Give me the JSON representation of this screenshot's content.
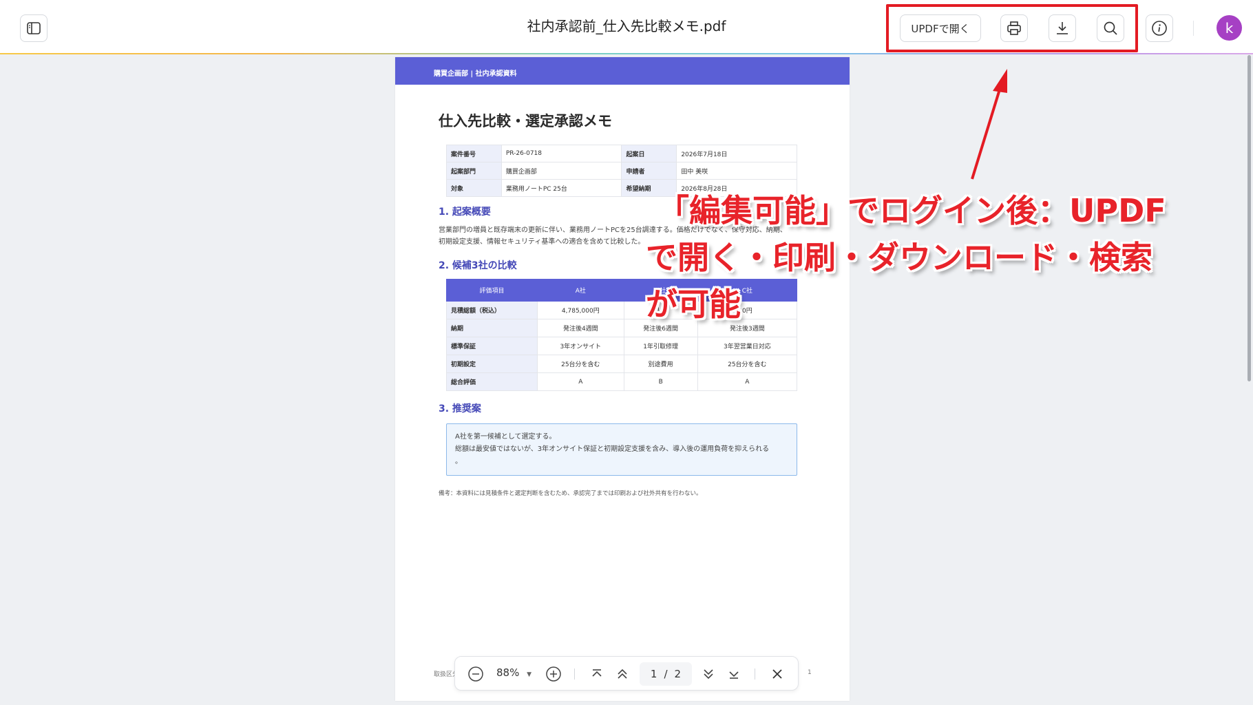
{
  "header": {
    "title": "社内承認前_仕入先比較メモ.pdf",
    "open_in_updf_label": "UPDFで開く",
    "avatar_initial": "k"
  },
  "document": {
    "header_band": "購買企画部 | 社内承認資料",
    "title": "仕入先比較・選定承認メモ",
    "meta": [
      {
        "k1": "案件番号",
        "v1": "PR-26-0718",
        "k2": "起案日",
        "v2": "2026年7月18日"
      },
      {
        "k1": "起案部門",
        "v1": "購買企画部",
        "k2": "申請者",
        "v2": "田中 美咲"
      },
      {
        "k1": "対象",
        "v1": "業務用ノートPC 25台",
        "k2": "希望納期",
        "v2": "2026年8月28日"
      }
    ],
    "sections": {
      "s1": "1. 起案概要",
      "s2": "2. 候補3社の比較",
      "s3": "3. 推奨案"
    },
    "summary_lines": [
      "営業部門の増員と既存端末の更新に伴い、業務用ノートPCを25台調達する。価格だけでなく、保守対応、納期、",
      "初期設定支援、情報セキュリティ基準への適合を含めて比較した。"
    ],
    "comparison": {
      "headers": [
        "評価項目",
        "A社",
        "B社",
        "C社"
      ],
      "rows": [
        [
          "見積総額（税込）",
          "4,785,000円",
          "4,6",
          "0円"
        ],
        [
          "納期",
          "発注後4週間",
          "発注後6週間",
          "発注後3週間"
        ],
        [
          "標準保証",
          "3年オンサイト",
          "1年引取修理",
          "3年翌営業日対応"
        ],
        [
          "初期設定",
          "25台分を含む",
          "別途費用",
          "25台分を含む"
        ],
        [
          "総合評価",
          "A",
          "B",
          "A"
        ]
      ]
    },
    "recommendation_lines": [
      "A社を第一候補として選定する。",
      "総額は最安値ではないが、3年オンサイト保証と初期設定支援を含み、導入後の運用負荷を抑えられる",
      "。"
    ],
    "note": "備考：本資料には見積条件と選定判断を含むため、承認完了までは印刷および社外共有を行わない。"
  },
  "bottom_toolbar": {
    "zoom": "88%",
    "current_page": "1",
    "page_separator": "/",
    "total_pages": "2",
    "left_edge_text": "取扱区分",
    "right_edge_text": "1"
  },
  "annotation": {
    "line1": "「編集可能」でログイン後：UPDF",
    "line2": "で開く・印刷・ダウンロード・検索",
    "line3": "が可能",
    "color": "#e8232a"
  },
  "icons": {
    "sidebar": "sidebar-toggle-icon",
    "print": "printer-icon",
    "download": "download-icon",
    "search": "search-icon",
    "info": "info-icon"
  }
}
